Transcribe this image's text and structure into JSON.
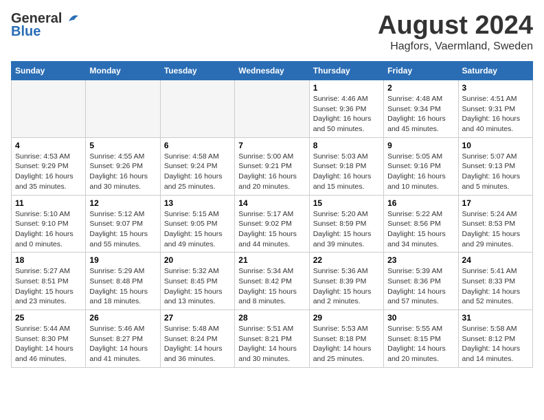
{
  "header": {
    "logo_general": "General",
    "logo_blue": "Blue",
    "month_title": "August 2024",
    "location": "Hagfors, Vaermland, Sweden"
  },
  "days_of_week": [
    "Sunday",
    "Monday",
    "Tuesday",
    "Wednesday",
    "Thursday",
    "Friday",
    "Saturday"
  ],
  "weeks": [
    {
      "days": [
        {
          "num": "",
          "empty": true
        },
        {
          "num": "",
          "empty": true
        },
        {
          "num": "",
          "empty": true
        },
        {
          "num": "",
          "empty": true
        },
        {
          "num": "1",
          "info": "Sunrise: 4:46 AM\nSunset: 9:36 PM\nDaylight: 16 hours and 50 minutes."
        },
        {
          "num": "2",
          "info": "Sunrise: 4:48 AM\nSunset: 9:34 PM\nDaylight: 16 hours and 45 minutes."
        },
        {
          "num": "3",
          "info": "Sunrise: 4:51 AM\nSunset: 9:31 PM\nDaylight: 16 hours and 40 minutes."
        }
      ]
    },
    {
      "alt": true,
      "days": [
        {
          "num": "4",
          "info": "Sunrise: 4:53 AM\nSunset: 9:29 PM\nDaylight: 16 hours and 35 minutes."
        },
        {
          "num": "5",
          "info": "Sunrise: 4:55 AM\nSunset: 9:26 PM\nDaylight: 16 hours and 30 minutes."
        },
        {
          "num": "6",
          "info": "Sunrise: 4:58 AM\nSunset: 9:24 PM\nDaylight: 16 hours and 25 minutes."
        },
        {
          "num": "7",
          "info": "Sunrise: 5:00 AM\nSunset: 9:21 PM\nDaylight: 16 hours and 20 minutes."
        },
        {
          "num": "8",
          "info": "Sunrise: 5:03 AM\nSunset: 9:18 PM\nDaylight: 16 hours and 15 minutes."
        },
        {
          "num": "9",
          "info": "Sunrise: 5:05 AM\nSunset: 9:16 PM\nDaylight: 16 hours and 10 minutes."
        },
        {
          "num": "10",
          "info": "Sunrise: 5:07 AM\nSunset: 9:13 PM\nDaylight: 16 hours and 5 minutes."
        }
      ]
    },
    {
      "days": [
        {
          "num": "11",
          "info": "Sunrise: 5:10 AM\nSunset: 9:10 PM\nDaylight: 16 hours and 0 minutes."
        },
        {
          "num": "12",
          "info": "Sunrise: 5:12 AM\nSunset: 9:07 PM\nDaylight: 15 hours and 55 minutes."
        },
        {
          "num": "13",
          "info": "Sunrise: 5:15 AM\nSunset: 9:05 PM\nDaylight: 15 hours and 49 minutes."
        },
        {
          "num": "14",
          "info": "Sunrise: 5:17 AM\nSunset: 9:02 PM\nDaylight: 15 hours and 44 minutes."
        },
        {
          "num": "15",
          "info": "Sunrise: 5:20 AM\nSunset: 8:59 PM\nDaylight: 15 hours and 39 minutes."
        },
        {
          "num": "16",
          "info": "Sunrise: 5:22 AM\nSunset: 8:56 PM\nDaylight: 15 hours and 34 minutes."
        },
        {
          "num": "17",
          "info": "Sunrise: 5:24 AM\nSunset: 8:53 PM\nDaylight: 15 hours and 29 minutes."
        }
      ]
    },
    {
      "alt": true,
      "days": [
        {
          "num": "18",
          "info": "Sunrise: 5:27 AM\nSunset: 8:51 PM\nDaylight: 15 hours and 23 minutes."
        },
        {
          "num": "19",
          "info": "Sunrise: 5:29 AM\nSunset: 8:48 PM\nDaylight: 15 hours and 18 minutes."
        },
        {
          "num": "20",
          "info": "Sunrise: 5:32 AM\nSunset: 8:45 PM\nDaylight: 15 hours and 13 minutes."
        },
        {
          "num": "21",
          "info": "Sunrise: 5:34 AM\nSunset: 8:42 PM\nDaylight: 15 hours and 8 minutes."
        },
        {
          "num": "22",
          "info": "Sunrise: 5:36 AM\nSunset: 8:39 PM\nDaylight: 15 hours and 2 minutes."
        },
        {
          "num": "23",
          "info": "Sunrise: 5:39 AM\nSunset: 8:36 PM\nDaylight: 14 hours and 57 minutes."
        },
        {
          "num": "24",
          "info": "Sunrise: 5:41 AM\nSunset: 8:33 PM\nDaylight: 14 hours and 52 minutes."
        }
      ]
    },
    {
      "days": [
        {
          "num": "25",
          "info": "Sunrise: 5:44 AM\nSunset: 8:30 PM\nDaylight: 14 hours and 46 minutes."
        },
        {
          "num": "26",
          "info": "Sunrise: 5:46 AM\nSunset: 8:27 PM\nDaylight: 14 hours and 41 minutes."
        },
        {
          "num": "27",
          "info": "Sunrise: 5:48 AM\nSunset: 8:24 PM\nDaylight: 14 hours and 36 minutes."
        },
        {
          "num": "28",
          "info": "Sunrise: 5:51 AM\nSunset: 8:21 PM\nDaylight: 14 hours and 30 minutes."
        },
        {
          "num": "29",
          "info": "Sunrise: 5:53 AM\nSunset: 8:18 PM\nDaylight: 14 hours and 25 minutes."
        },
        {
          "num": "30",
          "info": "Sunrise: 5:55 AM\nSunset: 8:15 PM\nDaylight: 14 hours and 20 minutes."
        },
        {
          "num": "31",
          "info": "Sunrise: 5:58 AM\nSunset: 8:12 PM\nDaylight: 14 hours and 14 minutes."
        }
      ]
    }
  ]
}
